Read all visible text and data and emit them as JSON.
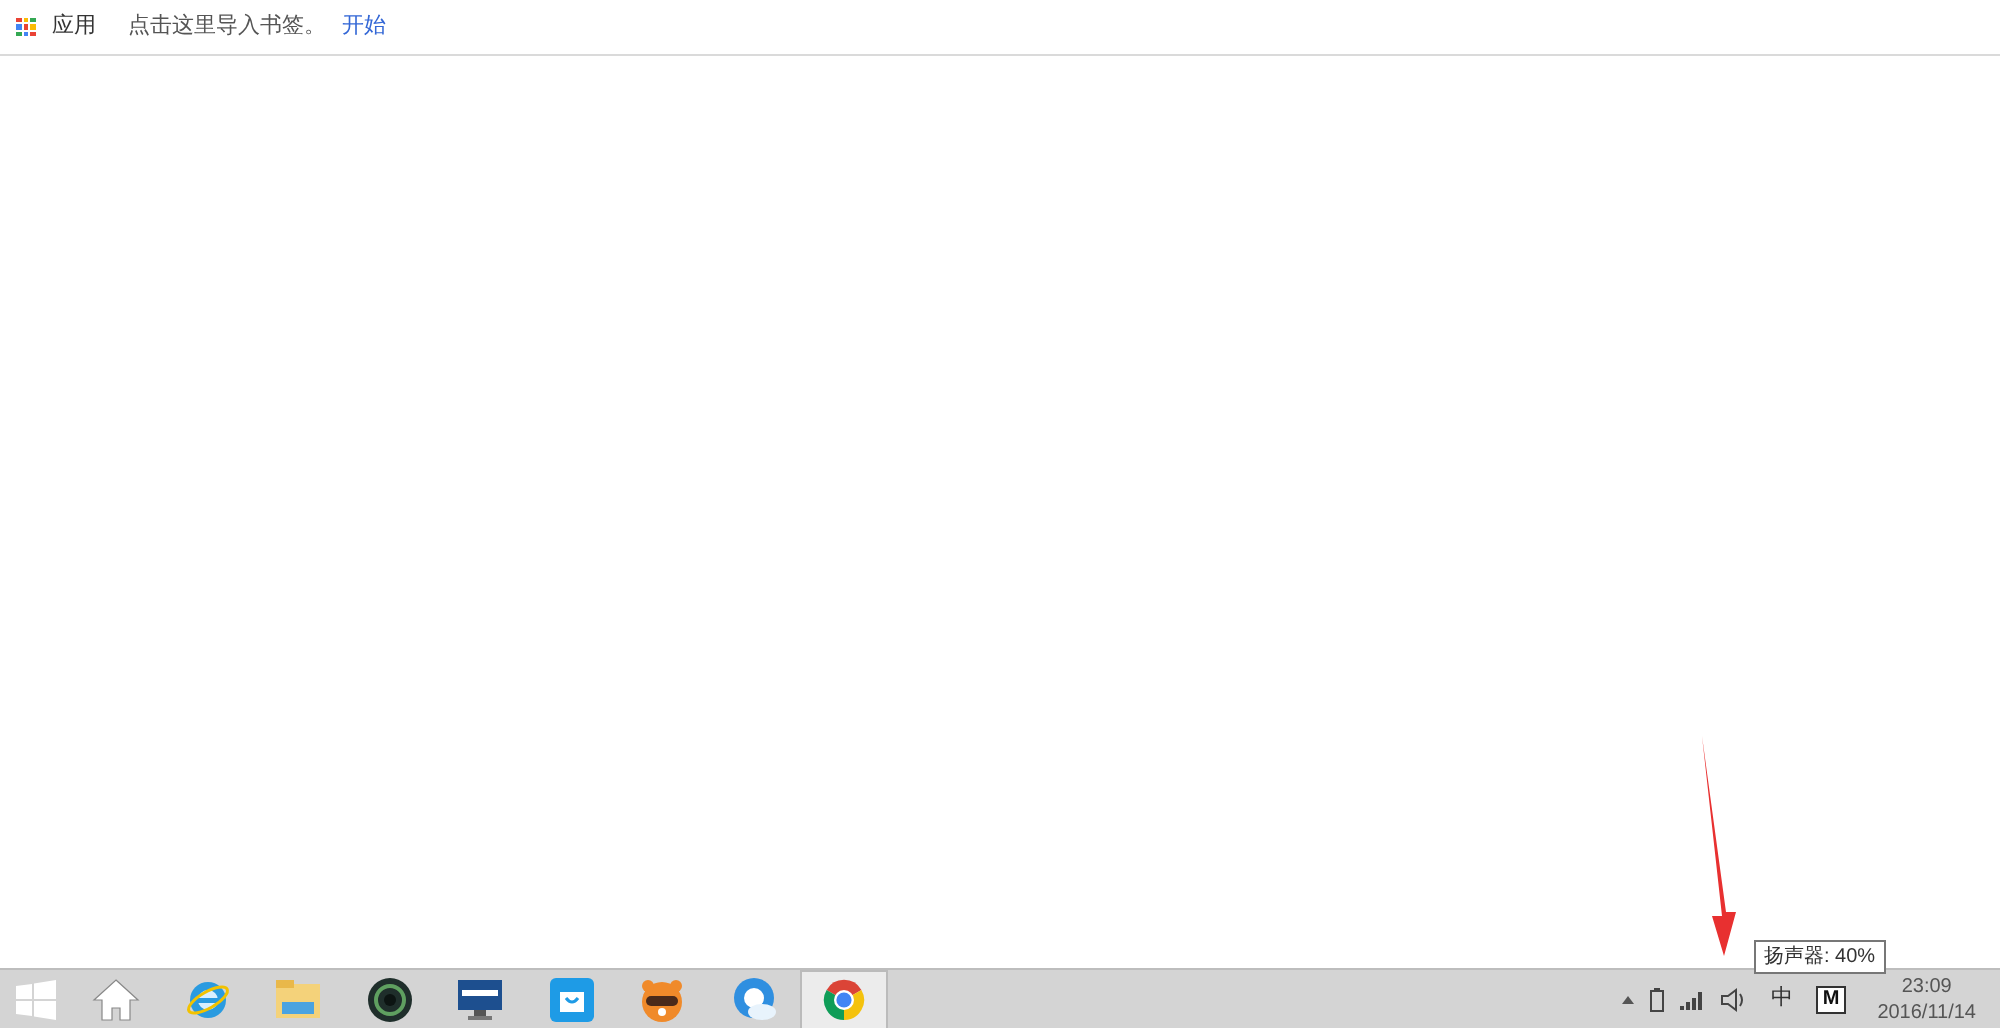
{
  "bookmarks_bar": {
    "apps_label": "应用",
    "hint": "点击这里导入书签。",
    "link": "开始"
  },
  "tooltip": {
    "text": "扬声器: 40%"
  },
  "taskbar": {
    "apps": [
      {
        "kind": "home",
        "selected": false
      },
      {
        "kind": "ie",
        "selected": false
      },
      {
        "kind": "folder",
        "selected": false
      },
      {
        "kind": "camera",
        "selected": false
      },
      {
        "kind": "monitor",
        "selected": false
      },
      {
        "kind": "store",
        "selected": false
      },
      {
        "kind": "raccoon",
        "selected": false
      },
      {
        "kind": "cloud",
        "selected": false
      },
      {
        "kind": "chrome",
        "selected": true
      }
    ],
    "ime": "中",
    "ime_mode": "M",
    "time": "23:09",
    "date": "2016/11/14"
  }
}
